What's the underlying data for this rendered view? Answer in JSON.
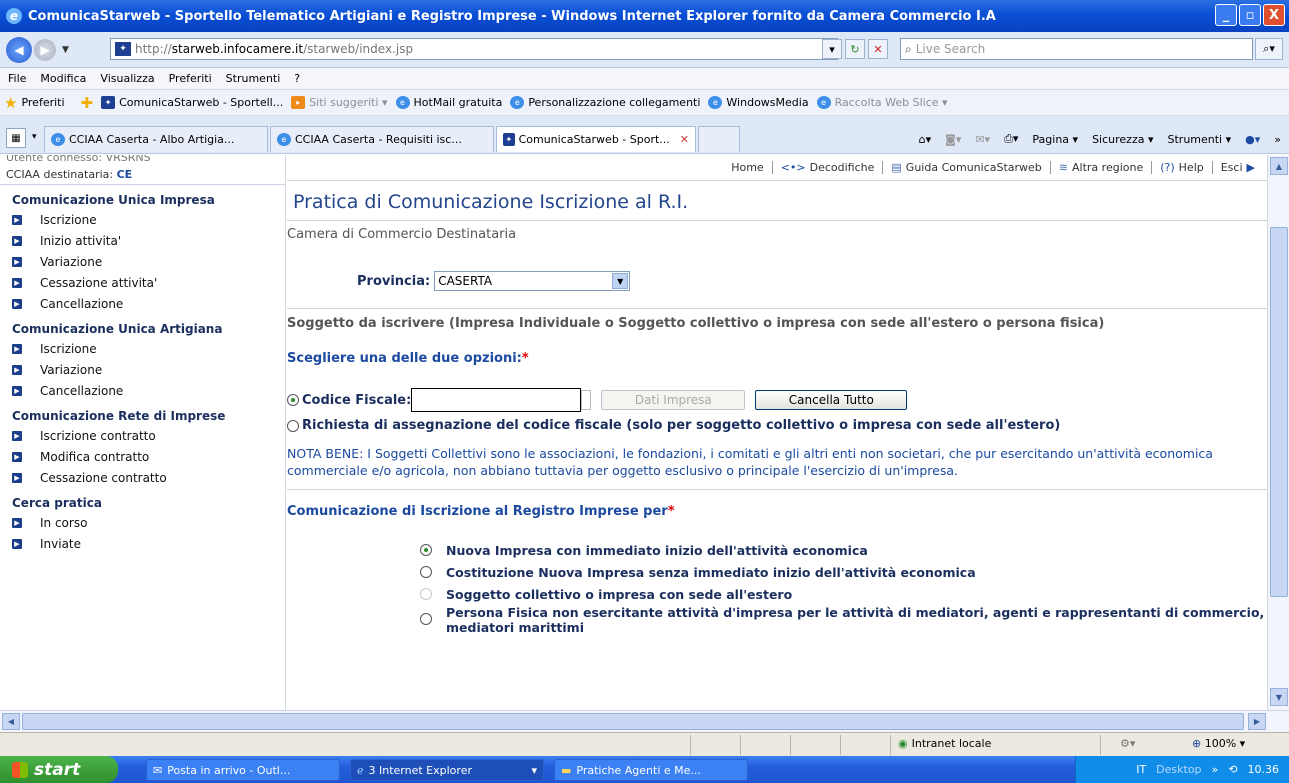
{
  "window": {
    "title": "ComunicaStarweb - Sportello Telematico Artigiani e Registro Imprese - Windows Internet Explorer fornito da Camera Commercio I.A",
    "min": "_",
    "max": "▫",
    "close": "X"
  },
  "address": {
    "url_prefix": "http://",
    "url_host": "starweb.infocamere.it",
    "url_path": "/starweb/index.jsp",
    "search_placeholder": "Live Search"
  },
  "menu": [
    "File",
    "Modifica",
    "Visualizza",
    "Preferiti",
    "Strumenti",
    "?"
  ],
  "favorites": {
    "label": "Preferiti",
    "items": [
      {
        "label": "ComunicaStarweb - Sportell...",
        "grey": false
      },
      {
        "label": "Siti suggeriti ▾",
        "grey": true
      },
      {
        "label": "HotMail gratuita",
        "grey": false
      },
      {
        "label": "Personalizzazione collegamenti",
        "grey": false
      },
      {
        "label": "WindowsMedia",
        "grey": false
      },
      {
        "label": "Raccolta Web Slice ▾",
        "grey": true
      }
    ]
  },
  "tabs": [
    {
      "label": "CCIAA Caserta - Albo Artigia...",
      "active": false
    },
    {
      "label": "CCIAA Caserta - Requisiti isc...",
      "active": false
    },
    {
      "label": "ComunicaStarweb - Sport...",
      "active": true
    }
  ],
  "command_bar": [
    "Pagina ▾",
    "Sicurezza ▾",
    "Strumenti ▾"
  ],
  "sidebar": {
    "user_line": "Utente connesso: VRSRNS",
    "cciaa_label": "CCIAA destinataria:",
    "cciaa_value": "CE",
    "sections": [
      {
        "title": "Comunicazione Unica Impresa",
        "items": [
          "Iscrizione",
          "Inizio attivita'",
          "Variazione",
          "Cessazione attivita'",
          "Cancellazione"
        ]
      },
      {
        "title": "Comunicazione Unica Artigiana",
        "items": [
          "Iscrizione",
          "Variazione",
          "Cancellazione"
        ]
      },
      {
        "title": "Comunicazione Rete di Imprese",
        "items": [
          "Iscrizione contratto",
          "Modifica contratto",
          "Cessazione contratto"
        ]
      },
      {
        "title": "Cerca pratica",
        "items": [
          "In corso",
          "Inviate"
        ]
      }
    ]
  },
  "topnav": [
    "Home",
    "Decodifiche",
    "Guida ComunicaStarweb",
    "Altra regione",
    "Help",
    "Esci"
  ],
  "main": {
    "page_title": "Pratica di Comunicazione Iscrizione al R.I.",
    "camera_heading": "Camera di Commercio Destinataria",
    "provincia_label": "Provincia:",
    "provincia_value": "CASERTA",
    "soggetto_heading": "Soggetto da iscrivere (Impresa Individuale o Soggetto collettivo o impresa con sede all'estero o persona fisica)",
    "scegliere_label": "Scegliere una delle due opzioni:",
    "required_mark": "*",
    "codice_fiscale_label": "Codice Fiscale:",
    "codice_fiscale_value": "",
    "dati_impresa_btn": "Dati Impresa",
    "cancella_tutto_btn": "Cancella Tutto",
    "richiesta_label": "Richiesta di assegnazione del codice fiscale (solo per soggetto collettivo o impresa con sede all'estero)",
    "nota_bene": "NOTA BENE: I Soggetti Collettivi sono le associazioni, le fondazioni, i comitati e gli altri enti non societari, che pur esercitando un'attività economica commerciale e/o agricola, non abbiano tuttavia per oggetto esclusivo o principale l'esercizio di un'impresa.",
    "comunicazione_label": "Comunicazione di Iscrizione al Registro Imprese per",
    "options": [
      "Nuova Impresa con immediato inizio dell'attività economica",
      "Costituzione Nuova Impresa senza immediato inizio dell'attività economica",
      "Soggetto collettivo o impresa con sede all'estero",
      "Persona Fisica non esercitante attività d'impresa per le attività di mediatori, agenti e rappresentanti di commercio, mediatori marittimi"
    ]
  },
  "status": {
    "zone": "Intranet locale",
    "zoom": "100%"
  },
  "taskbar": {
    "start": "start",
    "tasks": [
      "Posta in arrivo - Outl...",
      "3 Internet Explorer",
      "Pratiche Agenti e Me..."
    ],
    "lang": "IT",
    "desktop": "Desktop",
    "clock": "10.36"
  }
}
